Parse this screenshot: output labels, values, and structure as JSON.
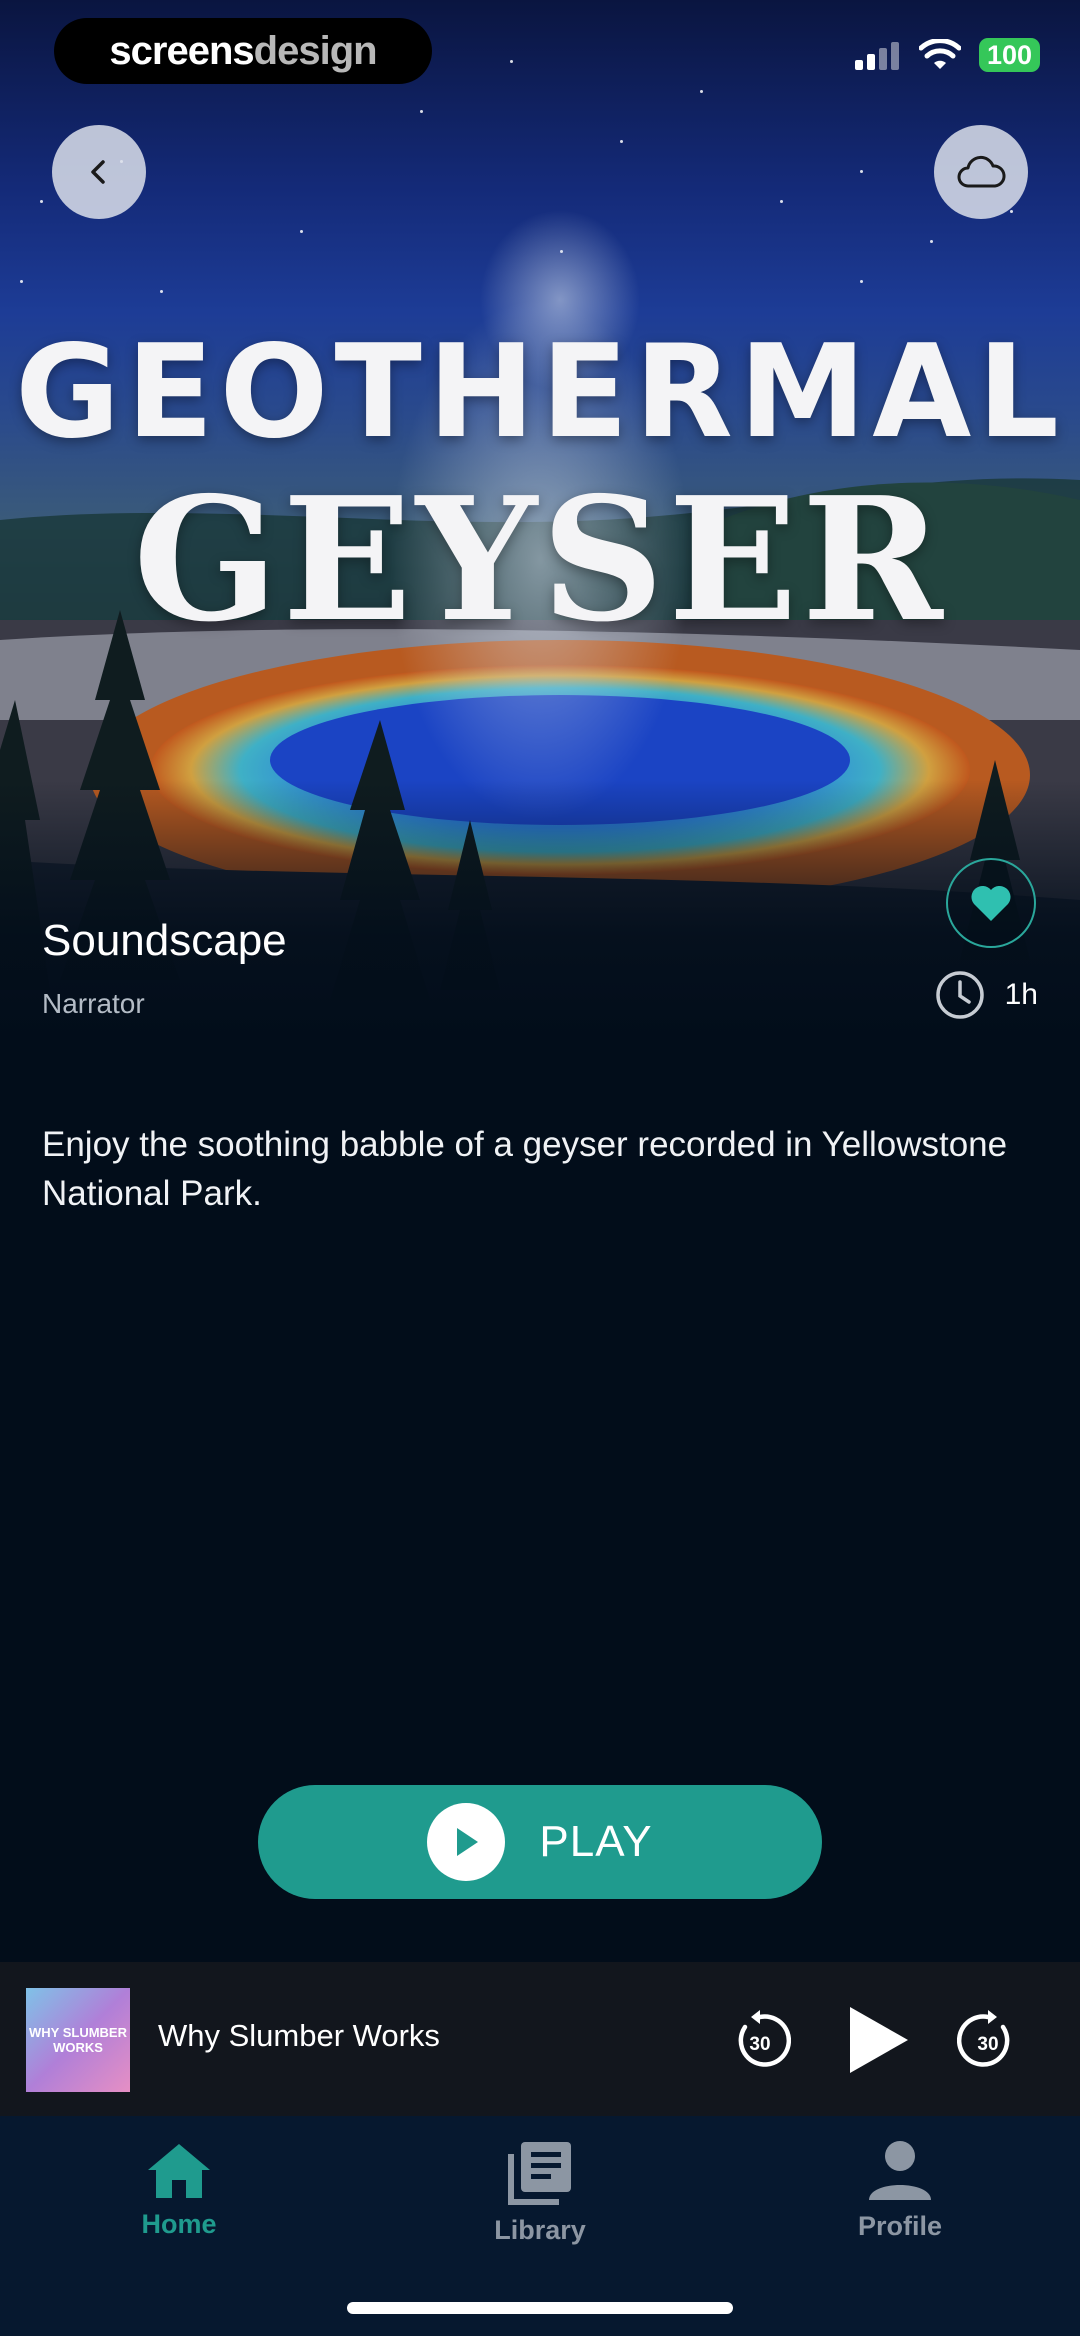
{
  "status_bar": {
    "brand_part1": "screens",
    "brand_part2": "design",
    "battery": "100"
  },
  "hero": {
    "title_line1": "GEOTHERMAL",
    "title_line2": "GEYSER"
  },
  "meta": {
    "category": "Soundscape",
    "narrator": "Narrator",
    "duration": "1h"
  },
  "description": "Enjoy the soothing babble of a geyser recorded in Yellowstone National Park.",
  "play_button": {
    "label": "PLAY"
  },
  "mini_player": {
    "cover_text": "WHY SLUMBER WORKS",
    "title": "Why Slumber Works",
    "rewind_seconds": "30",
    "forward_seconds": "30"
  },
  "tabs": [
    {
      "label": "Home",
      "icon": "home-icon",
      "active": true
    },
    {
      "label": "Library",
      "icon": "library-icon",
      "active": false
    },
    {
      "label": "Profile",
      "icon": "profile-icon",
      "active": false
    }
  ],
  "colors": {
    "accent": "#1f9b8e",
    "background": "#020d1a",
    "tabbar": "#06182f",
    "inactive": "#8c96a3"
  }
}
